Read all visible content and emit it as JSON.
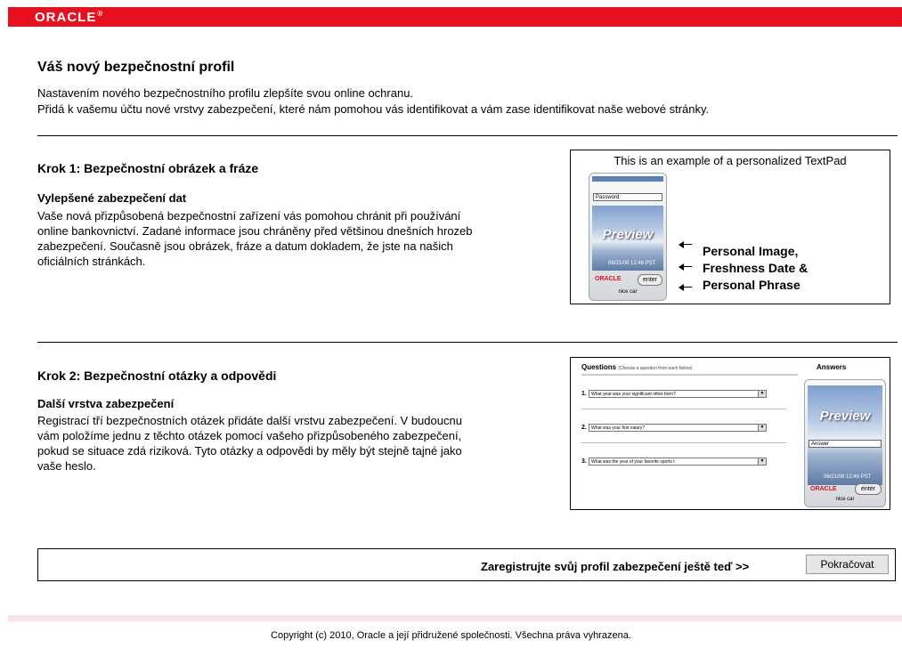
{
  "header": {
    "logo_text": "ORACLE",
    "logo_mark": "®",
    "brand_color": "#e8101c"
  },
  "page": {
    "title": "Váš nový bezpečnostní profil",
    "intro_lines": [
      "Nastavením nového bezpečnostního profilu zlepšíte svou online ochranu.",
      "Přidá k vašemu účtu nové vrstvy zabezpečení, které nám pomohou vás identifikovat a vám zase identifikovat naše webové stránky."
    ]
  },
  "step1": {
    "title": "Krok 1: Bezpečnostní obrázek a fráze",
    "subtitle": "Vylepšené zabezpečení dat",
    "body": "Vaše nová přizpůsobená bezpečnostní zařízení vás pomohou chránit při používání online bankovnictví. Zadané informace jsou chráněny před většinou dnešních hrozeb zabezpečení. Současně jsou obrázek, fráze a datum dokladem, že jste na našich oficiálních stránkách.",
    "example": {
      "caption": "This is an example of a personalized TextPad",
      "password_label": "Password:",
      "preview_text": "Preview",
      "date_text": "06/21/08 12:46 PST",
      "brand_text": "ORACLE",
      "enter_label": "enter",
      "phrase_text": "nice car",
      "labels": [
        "Personal Image,",
        "Freshness Date &",
        "Personal Phrase"
      ]
    }
  },
  "step2": {
    "title": "Krok 2: Bezpečnostní otázky a odpovědi",
    "subtitle": "Další vrstva zabezpečení",
    "body": "Registrací tří bezpečnostních otázek přidáte další vrstvu zabezpečení. V budoucnu vám položíme jednu z těchto otázek pomocí vašeho přizpůsobeného zabezpečení, pokud se situace zdá riziková. Tyto otázky a odpovědi by měly být stejně tajné jako vaše heslo.",
    "example": {
      "questions_heading": "Questions",
      "questions_hint": "(Choose a question from each below)",
      "answers_heading": "Answers",
      "questions": [
        {
          "num": "1.",
          "text": "What year was your significant other born?"
        },
        {
          "num": "2.",
          "text": "What was your first salary?"
        },
        {
          "num": "3.",
          "text": "What was the year of your favorite sports t"
        }
      ],
      "preview_text": "Preview",
      "answer_label": "Answer",
      "date_text": "06/21/08 12:46 PST",
      "brand_text": "ORACLE",
      "enter_label": "enter",
      "phrase_text": "nice car"
    }
  },
  "cta": {
    "label": "Zaregistrujte svůj profil zabezpečení ještě teď >>",
    "button": "Pokračovat"
  },
  "footer": {
    "copyright": "Copyright (c) 2010, Oracle a její přidružené společnosti. Všechna práva vyhrazena."
  }
}
